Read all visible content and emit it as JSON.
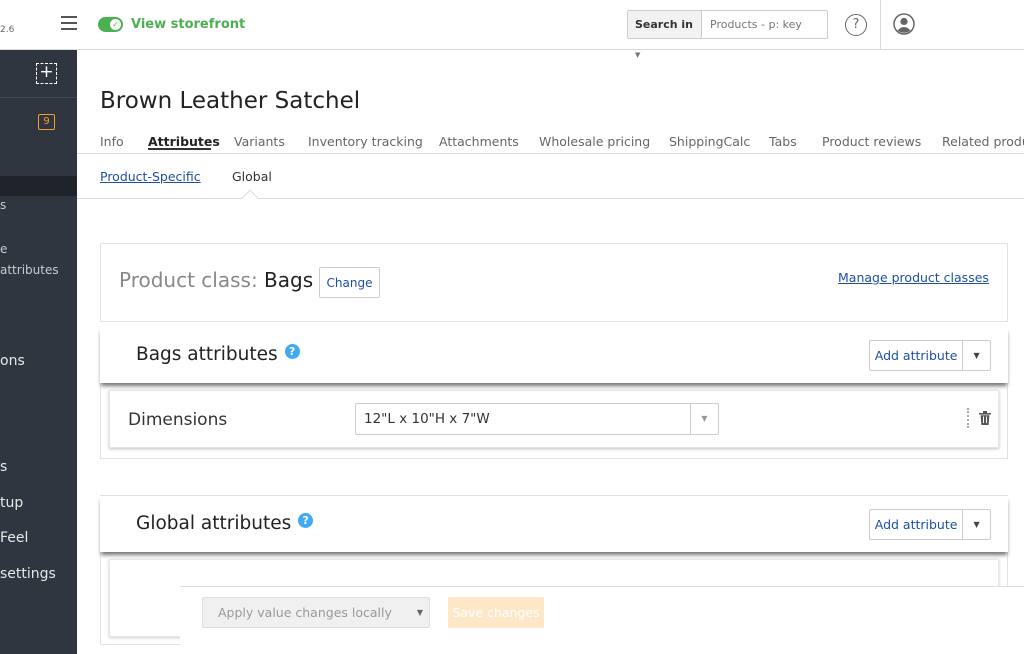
{
  "header": {
    "version": "2.6",
    "storefront_label": "View storefront",
    "search_in_label": "Search in",
    "search_placeholder": "Products - p: key",
    "help_glyph": "?"
  },
  "sidebar": {
    "add_glyph": "+",
    "badge_count": "9",
    "items": [
      {
        "label": "s"
      },
      {
        "label": "e"
      },
      {
        "label": "attributes"
      },
      {
        "label": "ons"
      },
      {
        "label": "s"
      },
      {
        "label": "tup"
      },
      {
        "label": "Feel"
      },
      {
        "label": "settings"
      }
    ]
  },
  "product": {
    "title": "Brown Leather Satchel"
  },
  "tabs": [
    {
      "label": "Info"
    },
    {
      "label": "Attributes"
    },
    {
      "label": "Variants"
    },
    {
      "label": "Inventory tracking"
    },
    {
      "label": "Attachments"
    },
    {
      "label": "Wholesale pricing"
    },
    {
      "label": "ShippingCalc"
    },
    {
      "label": "Tabs"
    },
    {
      "label": "Product reviews"
    },
    {
      "label": "Related produ"
    }
  ],
  "subtabs": [
    {
      "label": "Product-Specific"
    },
    {
      "label": "Global"
    }
  ],
  "product_class": {
    "label": "Product class:",
    "value": "Bags",
    "change_label": "Change",
    "manage_label": "Manage product classes"
  },
  "sections": {
    "bags": {
      "title": "Bags attributes",
      "add_label": "Add attribute",
      "attributes": [
        {
          "name": "Dimensions",
          "value": "12\"L x 10\"H x 7\"W"
        }
      ]
    },
    "global": {
      "title": "Global attributes",
      "add_label": "Add attribute"
    }
  },
  "bottom": {
    "apply_label": "Apply value changes locally",
    "save_label": "Save changes"
  },
  "colors": {
    "accent_green": "#4caf50",
    "link_blue": "#1f4fa3",
    "sidebar_bg": "#2f3640",
    "badge_orange": "#f0a030",
    "info_blue": "#3fa9f5",
    "save_disabled": "#fde7c6"
  },
  "icons": {
    "menu": "hamburger-icon",
    "toggle": "check-toggle-icon",
    "help": "question-icon",
    "user": "user-avatar-icon",
    "add": "plus-icon",
    "info": "info-icon",
    "trash": "trash-icon",
    "drag": "drag-handle-icon"
  }
}
